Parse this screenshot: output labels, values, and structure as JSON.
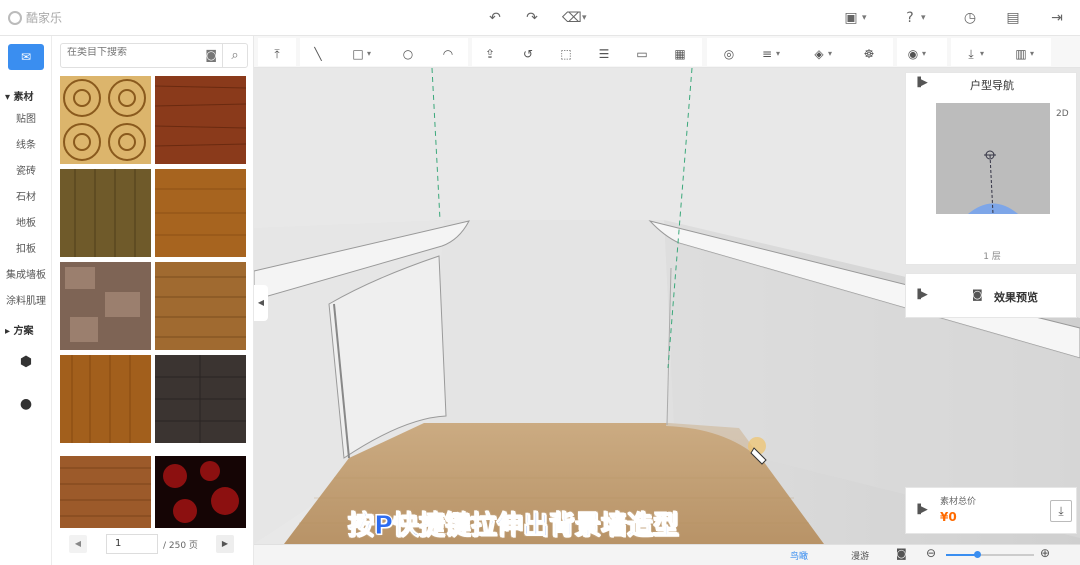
{
  "app": {
    "logo_text": "酷家乐"
  },
  "topbar": {
    "icons": [
      "undo-icon",
      "redo-icon",
      "eraser-icon",
      "save-menu-icon",
      "help-icon",
      "history-icon",
      "save-icon",
      "exit-icon"
    ]
  },
  "leftnav": {
    "section_materials": "▾ 素材",
    "items": [
      "贴图",
      "线条",
      "瓷砖",
      "石材",
      "地板",
      "扣板",
      "集成墙板",
      "涂料肌理"
    ],
    "section_plans": "▸ 方案"
  },
  "panel": {
    "search_placeholder": "在类目下搜索",
    "page_current": "1",
    "page_total": "/ 250 页",
    "tiles": [
      {
        "name": "ornate-parquet",
        "color": "#d9b267"
      },
      {
        "name": "cherry-wood",
        "color": "#8a3a1b"
      },
      {
        "name": "olive-oak",
        "color": "#6f5a2a"
      },
      {
        "name": "amber-wood",
        "color": "#a7641f"
      },
      {
        "name": "grey-cork",
        "color": "#7e6455"
      },
      {
        "name": "honey-oak",
        "color": "#a06a30"
      },
      {
        "name": "teak",
        "color": "#a25f1c"
      },
      {
        "name": "dark-slate-wood",
        "color": "#3b3431"
      },
      {
        "name": "striped-wood",
        "color": "#9c5a2a"
      },
      {
        "name": "red-granite",
        "color": "#7a0f0f"
      }
    ]
  },
  "right": {
    "nav_title": "户型导航",
    "mode_2d": "2D",
    "floor": "1 层",
    "preview_label": "效果预览",
    "cost_label": "素材总价",
    "cost_value": "¥0"
  },
  "caption": "按P快捷键拉伸出背景墙造型",
  "bottombar": {
    "view_aerial": "鸟瞰",
    "view_roam": "漫游"
  },
  "colors": {
    "accent": "#3a8ef0",
    "price": "#ff6a00",
    "caption": "#2d6cf0"
  }
}
